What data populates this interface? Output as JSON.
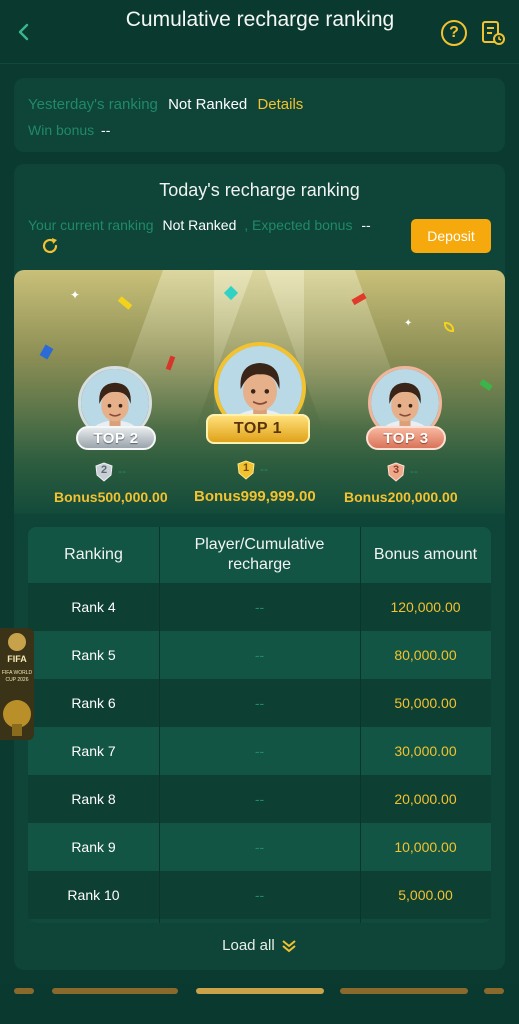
{
  "header": {
    "title": "Cumulative recharge ranking"
  },
  "yesterday": {
    "label": "Yesterday's ranking",
    "status": "Not Ranked",
    "details_link": "Details",
    "win_bonus_label": "Win bonus",
    "win_bonus_value": "--"
  },
  "today": {
    "title": "Today's recharge ranking",
    "current_label": "Your current ranking",
    "current_value": "Not Ranked",
    "expected_label": ", Expected bonus",
    "expected_value": "--",
    "deposit_button": "Deposit"
  },
  "podium": [
    {
      "badge": "TOP 2",
      "medal_num": "2",
      "player": "--",
      "bonus_label": "Bonus",
      "bonus_value": "500,000.00"
    },
    {
      "badge": "TOP 1",
      "medal_num": "1",
      "player": "--",
      "bonus_label": "Bonus",
      "bonus_value": "999,999.00"
    },
    {
      "badge": "TOP 3",
      "medal_num": "3",
      "player": "--",
      "bonus_label": "Bonus",
      "bonus_value": "200,000.00"
    }
  ],
  "table": {
    "headers": [
      "Ranking",
      "Player/Cumulative recharge",
      "Bonus amount"
    ],
    "rows": [
      {
        "rank": "Rank 4",
        "player": "--",
        "bonus": "120,000.00"
      },
      {
        "rank": "Rank 5",
        "player": "--",
        "bonus": "80,000.00"
      },
      {
        "rank": "Rank 6",
        "player": "--",
        "bonus": "50,000.00"
      },
      {
        "rank": "Rank 7",
        "player": "--",
        "bonus": "30,000.00"
      },
      {
        "rank": "Rank 8",
        "player": "--",
        "bonus": "20,000.00"
      },
      {
        "rank": "Rank 9",
        "player": "--",
        "bonus": "10,000.00"
      },
      {
        "rank": "Rank 10",
        "player": "--",
        "bonus": "5,000.00"
      }
    ]
  },
  "load_all": "Load all",
  "side_widget": {
    "top_text": "FIFA",
    "sub_text": "FIFA WORLD CUP 2026"
  },
  "colors": {
    "background": "#0b3b30",
    "card": "#0f4438",
    "accent_gold": "#f2c230",
    "deposit": "#f6a90c",
    "muted_green": "#1f8a68"
  },
  "icons": [
    "back-icon",
    "help-icon",
    "record-icon",
    "refresh-icon",
    "chevron-double-down-icon",
    "medal-icon"
  ]
}
